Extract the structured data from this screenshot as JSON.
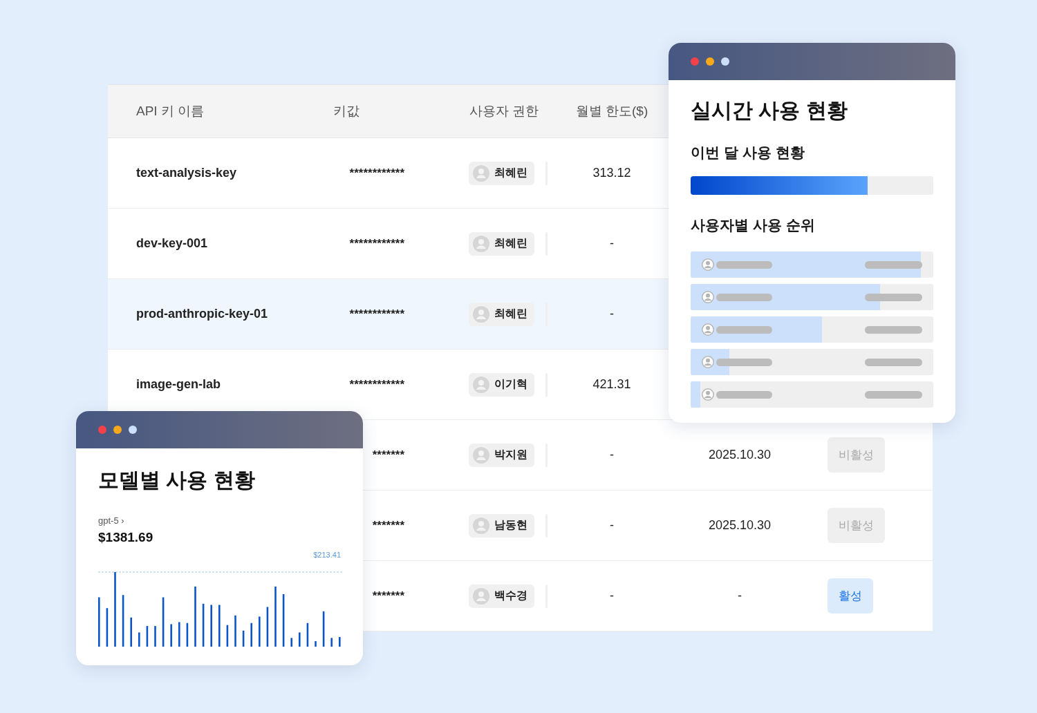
{
  "table": {
    "columns": [
      "API 키 이름",
      "키값",
      "사용자 권한",
      "월별 한도($)"
    ],
    "rows": [
      {
        "name": "text-analysis-key",
        "key": "************",
        "user": "최혜린",
        "limit": "313.12",
        "selected": false
      },
      {
        "name": "dev-key-001",
        "key": "************",
        "user": "최혜린",
        "limit": "-",
        "selected": false
      },
      {
        "name": "prod-anthropic-key-01",
        "key": "************",
        "user": "최혜린",
        "limit": "-",
        "selected": true
      },
      {
        "name": "image-gen-lab",
        "key": "************",
        "user": "이기혁",
        "limit": "421.31",
        "selected": false
      },
      {
        "key": "*******",
        "user": "박지원",
        "limit": "-",
        "date": "2025.10.30",
        "status": {
          "label": "비활성",
          "active": false
        },
        "selected": false
      },
      {
        "key": "*******",
        "user": "남동현",
        "limit": "-",
        "date": "2025.10.30",
        "status": {
          "label": "비활성",
          "active": false
        },
        "selected": false
      },
      {
        "key": "*******",
        "user": "백수경",
        "limit": "-",
        "date": "-",
        "status": {
          "label": "활성",
          "active": true
        },
        "selected": false
      }
    ]
  },
  "realtime_card": {
    "title": "실시간 사용 현황",
    "month_label": "이번 달 사용 현황",
    "month_usage": {
      "level": 0.73
    },
    "ranking_label": "사용자별 사용 순위",
    "ranking": [
      {
        "level": 0.95
      },
      {
        "level": 0.78
      },
      {
        "level": 0.54
      },
      {
        "level": 0.16
      },
      {
        "level": 0.04
      }
    ]
  },
  "model_card": {
    "title": "모델별 사용 현황",
    "model": "gpt-5",
    "chevron": "›",
    "total": "$1381.69",
    "peak_label": "$213.41"
  }
}
